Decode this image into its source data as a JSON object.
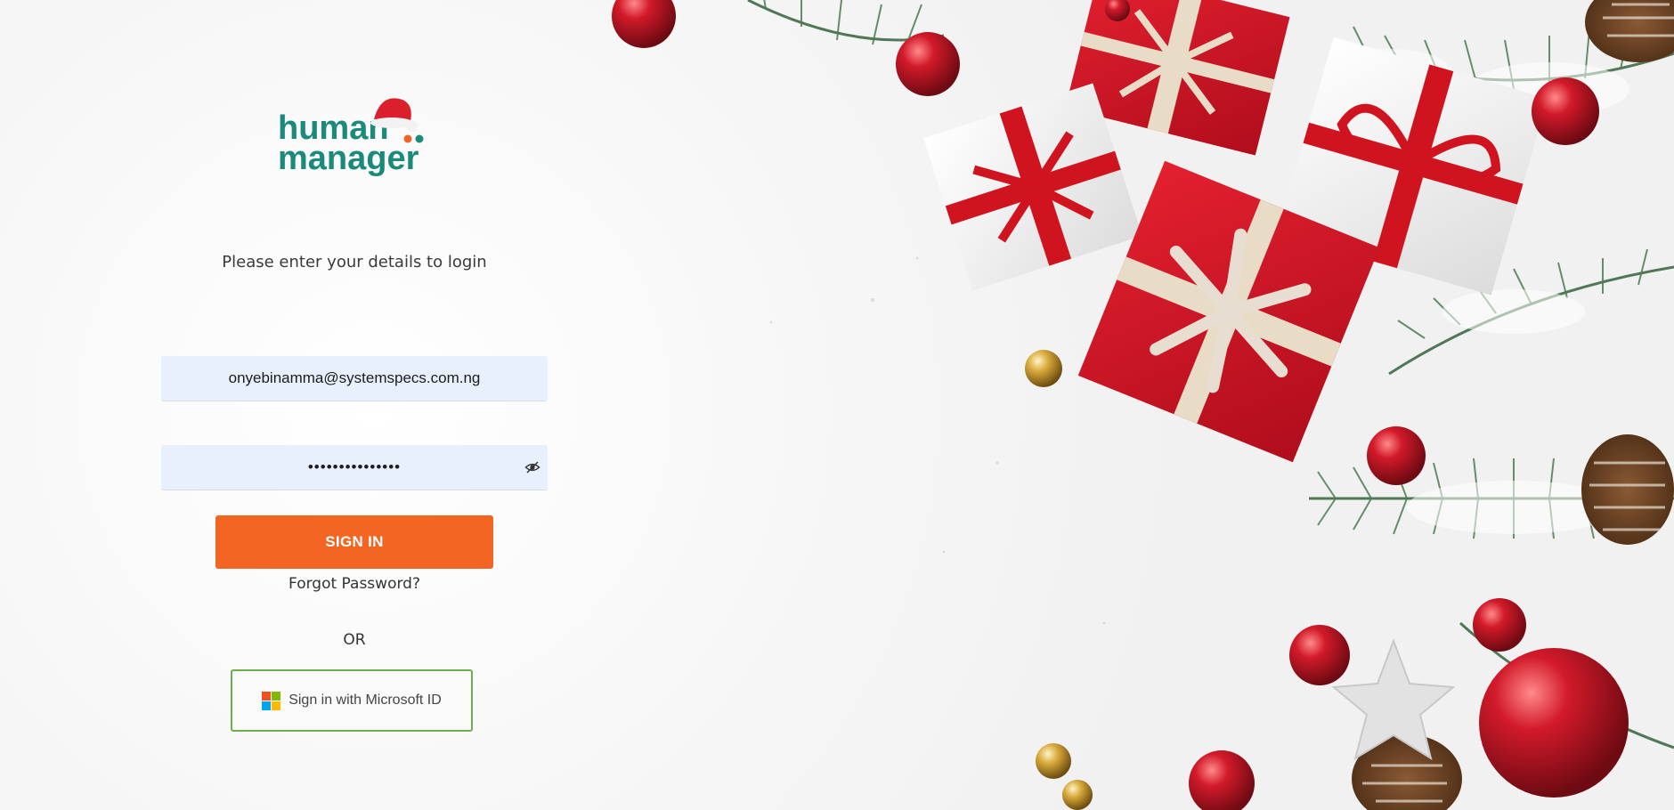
{
  "brand": {
    "logo_line1": "human",
    "logo_line2": "manager",
    "teal": "#1b8a7a",
    "orange": "#f26522"
  },
  "login": {
    "subtitle": "Please enter your details to login",
    "email_value": "onyebinamma@systemspecs.com.ng",
    "password_value": "•••••••••••••••",
    "show_password_icon": "eye-slash-icon",
    "signin_label": "SIGN IN",
    "forgot_label": "Forgot Password?",
    "or_label": "OR",
    "microsoft_label": "Sign in with Microsoft ID",
    "microsoft_icon": "microsoft-logo-icon"
  },
  "decoration": {
    "theme": "christmas-gifts-ornaments",
    "colors": [
      "#c8102e",
      "#ffffff",
      "#3f6b45",
      "#d4af37"
    ]
  }
}
